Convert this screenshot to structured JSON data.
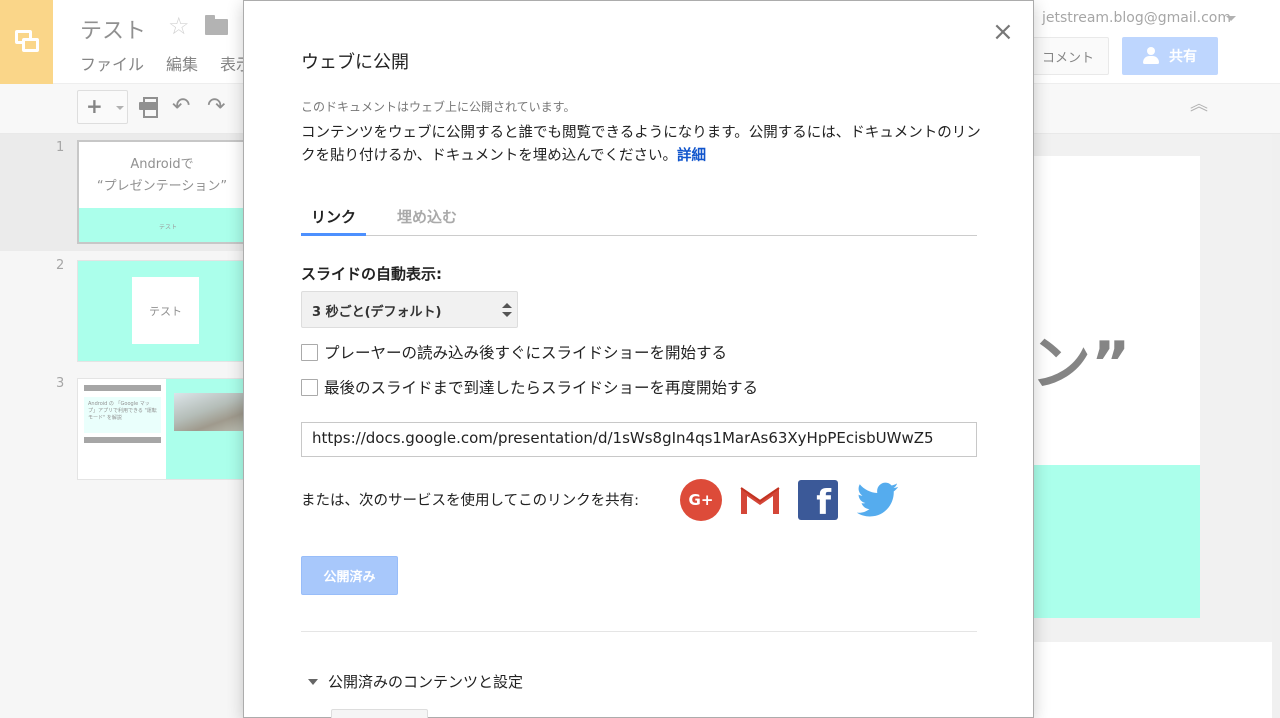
{
  "app": {
    "doc_title": "テスト",
    "menu": [
      "ファイル",
      "編集",
      "表示"
    ],
    "account_email": "jetstream.blog@gmail.com",
    "comment_label": "コメント",
    "share_label": "共有",
    "accent_color": "#4d90fe",
    "logo_color": "#f7c14b"
  },
  "filmstrip": {
    "slides": [
      {
        "number": "1",
        "title_line1": "Androidで",
        "title_line2": "“プレゼンテーション”",
        "footer": "テスト"
      },
      {
        "number": "2",
        "card_text": "テスト"
      },
      {
        "number": "3",
        "text": "Android の 「Google マップ」アプリで利用できる \"運転モード\" を解説"
      }
    ]
  },
  "main_slide": {
    "visible_text": "ン”",
    "band_color": "#7effe0"
  },
  "dialog": {
    "title": "ウェブに公開",
    "status": "このドキュメントはウェブ上に公開されています。",
    "description": "コンテンツをウェブに公開すると誰でも閲覧できるようになります。公開するには、ドキュメントのリンクを貼り付けるか、ドキュメントを埋め込んでください。",
    "details_link": "詳細",
    "tabs": [
      {
        "label": "リンク",
        "active": true
      },
      {
        "label": "埋め込む",
        "active": false
      }
    ],
    "auto_advance_label": "スライドの自動表示:",
    "interval_selected": "3 秒ごと(デフォルト)",
    "checkboxes": [
      {
        "label": "プレーヤーの読み込み後すぐにスライドショーを開始する",
        "checked": false
      },
      {
        "label": "最後のスライドまで到達したらスライドショーを再度開始する",
        "checked": false
      }
    ],
    "url": "https://docs.google.com/presentation/d/1sWs8gIn4qs1MarAs63XyHpPEcisbUWwZ5",
    "share_via_label": "または、次のサービスを使用してこのリンクを共有:",
    "social_icons": [
      "google-plus-icon",
      "gmail-icon",
      "facebook-icon",
      "twitter-icon"
    ],
    "gplus_text": "G+",
    "facebook_text": "f",
    "published_button": "公開済み",
    "settings_section": "公開済みのコンテンツと設定",
    "close_glyph": "×"
  }
}
